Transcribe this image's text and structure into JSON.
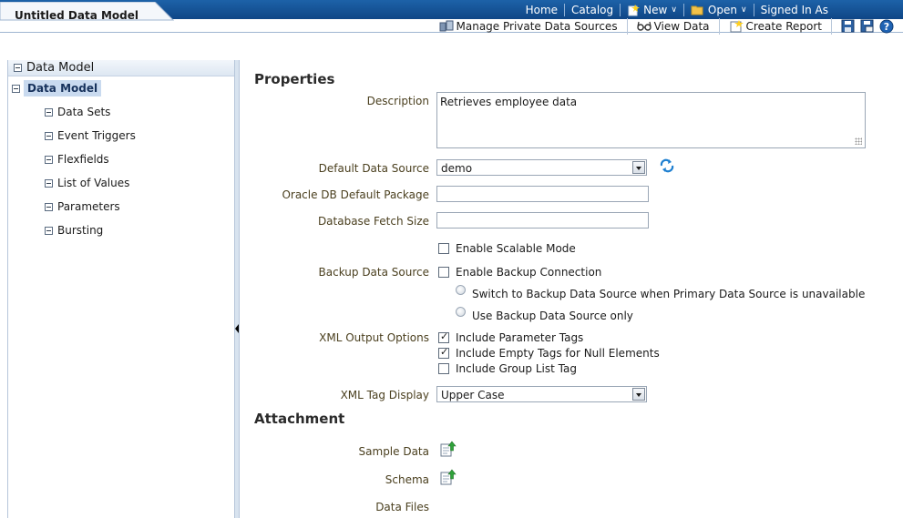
{
  "header": {
    "doc_tab": "Untitled Data Model",
    "global_links": {
      "home": "Home",
      "catalog": "Catalog",
      "new": "New",
      "open": "Open",
      "signed_in": "Signed In As"
    },
    "toolbar": {
      "manage_sources": "Manage Private Data Sources",
      "view_data": "View Data",
      "create_report": "Create Report"
    }
  },
  "sidebar": {
    "panel_title": "Data Model",
    "root": "Data Model",
    "items": [
      "Data Sets",
      "Event Triggers",
      "Flexfields",
      "List of Values",
      "Parameters",
      "Bursting"
    ]
  },
  "properties": {
    "title": "Properties",
    "description_label": "Description",
    "description_value": "Retrieves employee data",
    "default_source_label": "Default Data Source",
    "default_source_value": "demo",
    "db_package_label": "Oracle DB Default Package",
    "db_package_value": "",
    "fetch_size_label": "Database Fetch Size",
    "fetch_size_value": "",
    "scalable_label": "Enable Scalable Mode",
    "backup_label": "Backup Data Source",
    "backup_connection": "Enable Backup Connection",
    "backup_option1": "Switch to Backup Data Source when Primary Data Source is unavailable",
    "backup_option2": "Use Backup Data Source only",
    "xml_options_label": "XML Output Options",
    "xml_opt1": "Include Parameter Tags",
    "xml_opt2": "Include Empty Tags for Null Elements",
    "xml_opt3": "Include Group List Tag",
    "xml_tag_label": "XML Tag Display",
    "xml_tag_value": "Upper Case"
  },
  "attachment": {
    "title": "Attachment",
    "sample_label": "Sample Data",
    "schema_label": "Schema",
    "files_label": "Data Files"
  },
  "colors": {
    "header_blue": "#1d62a8",
    "label_text": "#4a3f1e",
    "selected_bg": "#c9daef"
  }
}
